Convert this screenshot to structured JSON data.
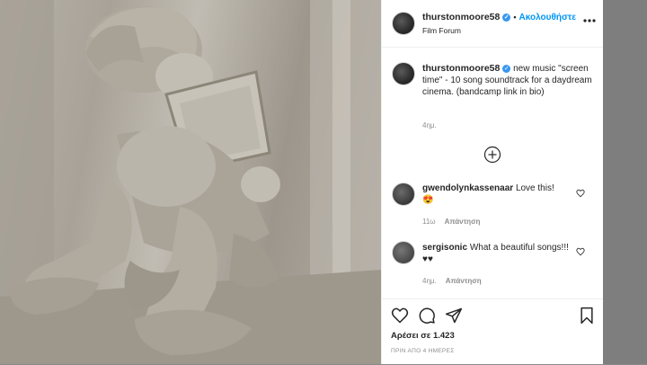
{
  "post": {
    "username": "thurstonmoore58",
    "verified_glyph": "✓",
    "follow_label": "Ακολουθήστε",
    "location": "Film Forum",
    "caption": "new music \"screen time\" - 10 song soundtrack for a daydream cinema. (bandcamp link in bio)",
    "caption_time": "4ημ.",
    "likes": "Αρέσει σε 1.423",
    "posted_ago": "ΠΡΙΝ ΑΠΟ 4 ΗΜΕΡΕΣ"
  },
  "comments": [
    {
      "username": "gwendolynkassenaar",
      "text": "Love this!",
      "emoji": "😍",
      "time": "11ω",
      "reply_label": "Απάντηση"
    },
    {
      "username": "sergisonic",
      "text": "What a beautiful songs!!! ♥♥",
      "time": "4ημ.",
      "reply_label": "Απάντηση"
    }
  ],
  "icons": [
    "more-icon",
    "verified-icon",
    "load-more-comments-icon",
    "heart-icon",
    "comment-icon",
    "share-icon",
    "bookmark-icon"
  ],
  "colors": {
    "accent": "#0095f6",
    "verified": "#3897f0",
    "text": "#262626",
    "muted": "#8e8e8e"
  }
}
